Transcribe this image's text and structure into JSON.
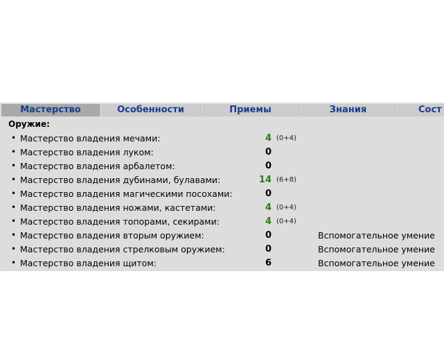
{
  "tabs": [
    {
      "label": "Мастерство",
      "active": true
    },
    {
      "label": "Особенности",
      "active": false
    },
    {
      "label": "Приемы",
      "active": false
    },
    {
      "label": "Знания",
      "active": false
    },
    {
      "label": "Сост",
      "active": false
    }
  ],
  "section": {
    "title": "Оружие:"
  },
  "skills": [
    {
      "label": "Мастерство владения мечами:",
      "value": "4",
      "value_color": "green",
      "bonus": "(0+4)",
      "note": ""
    },
    {
      "label": "Мастерство владения луком:",
      "value": "0",
      "value_color": "black",
      "bonus": "",
      "note": ""
    },
    {
      "label": "Мастерство владения арбалетом:",
      "value": "0",
      "value_color": "black",
      "bonus": "",
      "note": ""
    },
    {
      "label": "Мастерство владения дубинами, булавами:",
      "value": "14",
      "value_color": "green",
      "bonus": "(6+8)",
      "note": ""
    },
    {
      "label": "Мастерство владения магическими посохами:",
      "value": "0",
      "value_color": "black",
      "bonus": "",
      "note": ""
    },
    {
      "label": "Мастерство владения ножами, кастетами:",
      "value": "4",
      "value_color": "green",
      "bonus": "(0+4)",
      "note": ""
    },
    {
      "label": "Мастерство владения топорами, секирами:",
      "value": "4",
      "value_color": "green",
      "bonus": "(0+4)",
      "note": ""
    },
    {
      "label": "Мастерство владения вторым оружием:",
      "value": "0",
      "value_color": "black",
      "bonus": "",
      "note": "Вспомогательное умение"
    },
    {
      "label": "Мастерство владения стрелковым оружием:",
      "value": "0",
      "value_color": "black",
      "bonus": "",
      "note": "Вспомогательное умение"
    },
    {
      "label": "Мастерство владения щитом:",
      "value": "6",
      "value_color": "black",
      "bonus": "",
      "note": "Вспомогательное умение"
    }
  ],
  "colors": {
    "tab_text": "#1a3b8f",
    "value_green": "#2e7d10",
    "tab_active_bg": "#a9a9a9",
    "tab_bg": "#cccccc"
  }
}
